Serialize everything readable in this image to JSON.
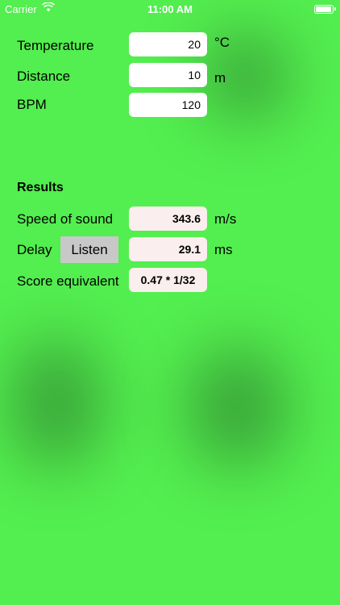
{
  "status_bar": {
    "carrier": "Carrier",
    "time": "11:00 AM",
    "battery_level": 1.0
  },
  "inputs": {
    "temperature": {
      "label": "Temperature",
      "value": "20",
      "unit": "°C"
    },
    "distance": {
      "label": "Distance",
      "value": "10",
      "unit": "m"
    },
    "bpm": {
      "label": "BPM",
      "value": "120"
    }
  },
  "results": {
    "heading": "Results",
    "speed_of_sound": {
      "label": "Speed of sound",
      "value": "343.6",
      "unit": "m/s"
    },
    "delay": {
      "label": "Delay",
      "button_label": "Listen",
      "value": "29.1",
      "unit": "ms"
    },
    "score_equivalent": {
      "label": "Score equivalent",
      "value": "0.47 * 1/32"
    }
  },
  "colors": {
    "background": "#53ee4f",
    "result_field": "#fbeeee",
    "listen_button": "#c8c8c8"
  }
}
